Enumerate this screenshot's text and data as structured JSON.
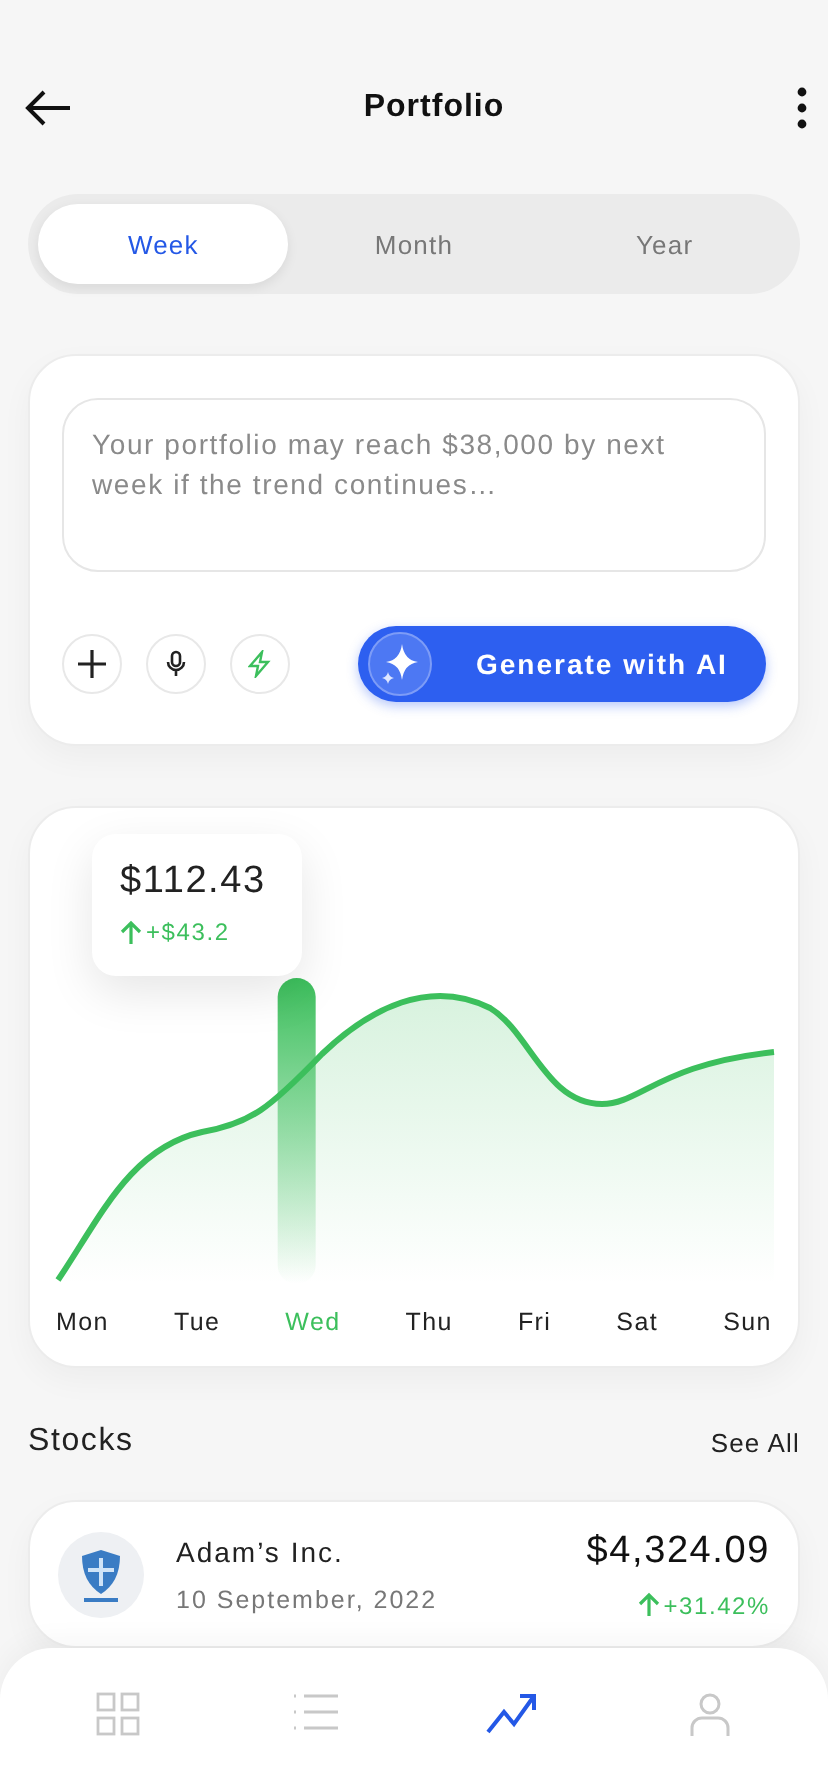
{
  "header": {
    "title": "Portfolio"
  },
  "periods": [
    {
      "label": "Week",
      "selected": true
    },
    {
      "label": "Month",
      "selected": false
    },
    {
      "label": "Year",
      "selected": false
    }
  ],
  "prompt": {
    "placeholder": "Your portfolio may reach $38,000 by next week if the trend continues…",
    "action": "Generate with AI"
  },
  "chart": {
    "tooltip": {
      "value": "$112.43",
      "change": "+$43.2"
    },
    "days": [
      {
        "label": "Mon",
        "selected": false
      },
      {
        "label": "Tue",
        "selected": false
      },
      {
        "label": "Wed",
        "selected": true
      },
      {
        "label": "Thu",
        "selected": false
      },
      {
        "label": "Fri",
        "selected": false
      },
      {
        "label": "Sat",
        "selected": false
      },
      {
        "label": "Sun",
        "selected": false
      }
    ]
  },
  "stocks": {
    "title": "Stocks",
    "link": "See All",
    "items": [
      {
        "name": "Adam’s Inc.",
        "date": "10 September, 2022",
        "price": "$4,324.09",
        "change": "+31.42%"
      }
    ]
  },
  "nav": [
    {
      "kind": "grid",
      "selected": false
    },
    {
      "kind": "list",
      "selected": false
    },
    {
      "kind": "trend",
      "selected": true
    },
    {
      "kind": "profile",
      "selected": false
    }
  ]
}
